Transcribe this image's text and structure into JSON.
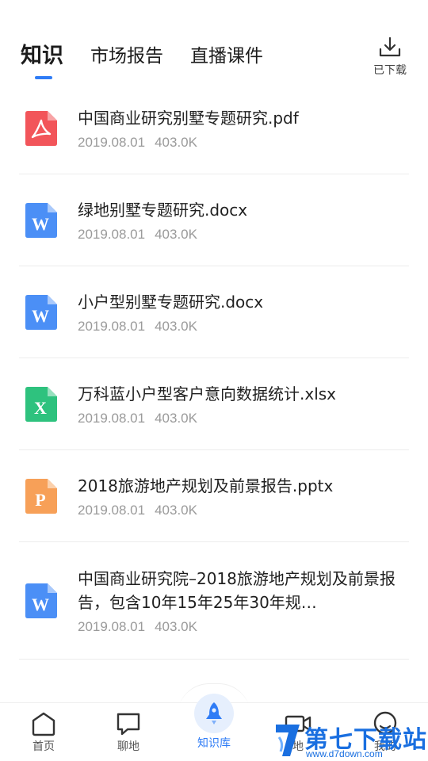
{
  "tabs": [
    {
      "label": "知识",
      "active": true
    },
    {
      "label": "市场报告",
      "active": false
    },
    {
      "label": "直播课件",
      "active": false
    }
  ],
  "downloaded": {
    "label": "已下载",
    "icon": "download-icon"
  },
  "files": [
    {
      "name": "中国商业研究别墅专题研究.pdf",
      "date": "2019.08.01",
      "size": "403.0K",
      "type": "pdf",
      "icon": "pdf-file-icon",
      "color": "#f2555a"
    },
    {
      "name": "绿地别墅专题研究.docx",
      "date": "2019.08.01",
      "size": "403.0K",
      "type": "docx",
      "icon": "word-file-icon",
      "color": "#4b8ff6"
    },
    {
      "name": "小户型别墅专题研究.docx",
      "date": "2019.08.01",
      "size": "403.0K",
      "type": "docx",
      "icon": "word-file-icon",
      "color": "#4b8ff6"
    },
    {
      "name": "万科蓝小户型客户意向数据统计.xlsx",
      "date": "2019.08.01",
      "size": "403.0K",
      "type": "xlsx",
      "icon": "excel-file-icon",
      "color": "#2ec27e"
    },
    {
      "name": "2018旅游地产规划及前景报告.pptx",
      "date": "2019.08.01",
      "size": "403.0K",
      "type": "pptx",
      "icon": "ppt-file-icon",
      "color": "#f7a058"
    },
    {
      "name": "中国商业研究院–2018旅游地产规划及前景报告，包含10年15年25年30年规…",
      "date": "2019.08.01",
      "size": "403.0K",
      "type": "docx",
      "icon": "word-file-icon",
      "color": "#4b8ff6"
    }
  ],
  "nav": [
    {
      "label": "首页",
      "icon": "home-icon",
      "active": false
    },
    {
      "label": "聊地",
      "icon": "chat-icon",
      "active": false
    },
    {
      "label": "知识库",
      "icon": "rocket-icon",
      "active": true
    },
    {
      "label": "地",
      "icon": "video-icon",
      "active": false
    },
    {
      "label": "我的",
      "icon": "profile-icon",
      "active": false
    }
  ],
  "watermark": {
    "text": "第七下载站",
    "url": "www.d7down.com"
  },
  "colors": {
    "accent": "#2f7cf6",
    "text": "#1f1f1f",
    "meta": "#9a9a9a"
  }
}
